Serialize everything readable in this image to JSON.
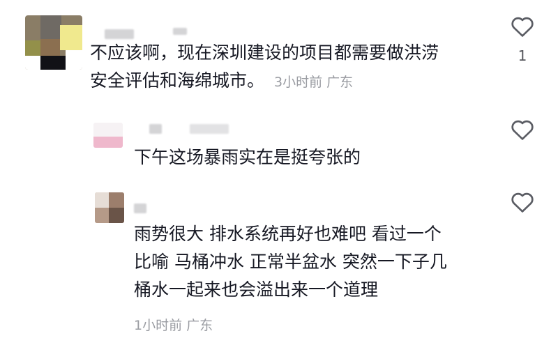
{
  "comments": [
    {
      "text_lines": [
        "不应该啊，现在深圳建设的项目都需要做洪涝",
        "安全评估和海绵城市。"
      ],
      "time": "3小时前",
      "location": "广东",
      "like_count": "1",
      "like_icon": "heart-outline-icon"
    },
    {
      "text_lines": [
        "下午这场暴雨实在是挺夸张的"
      ],
      "like_icon": "heart-outline-icon"
    },
    {
      "text_lines": [
        "雨势很大 排水系统再好也难吧 看过一个",
        "比喻 马桶冲水 正常半盆水 突然一下子几",
        "桶水一起来也会溢出来一个道理"
      ],
      "time": "1小时前",
      "location": "广东",
      "like_icon": "heart-outline-icon"
    }
  ]
}
